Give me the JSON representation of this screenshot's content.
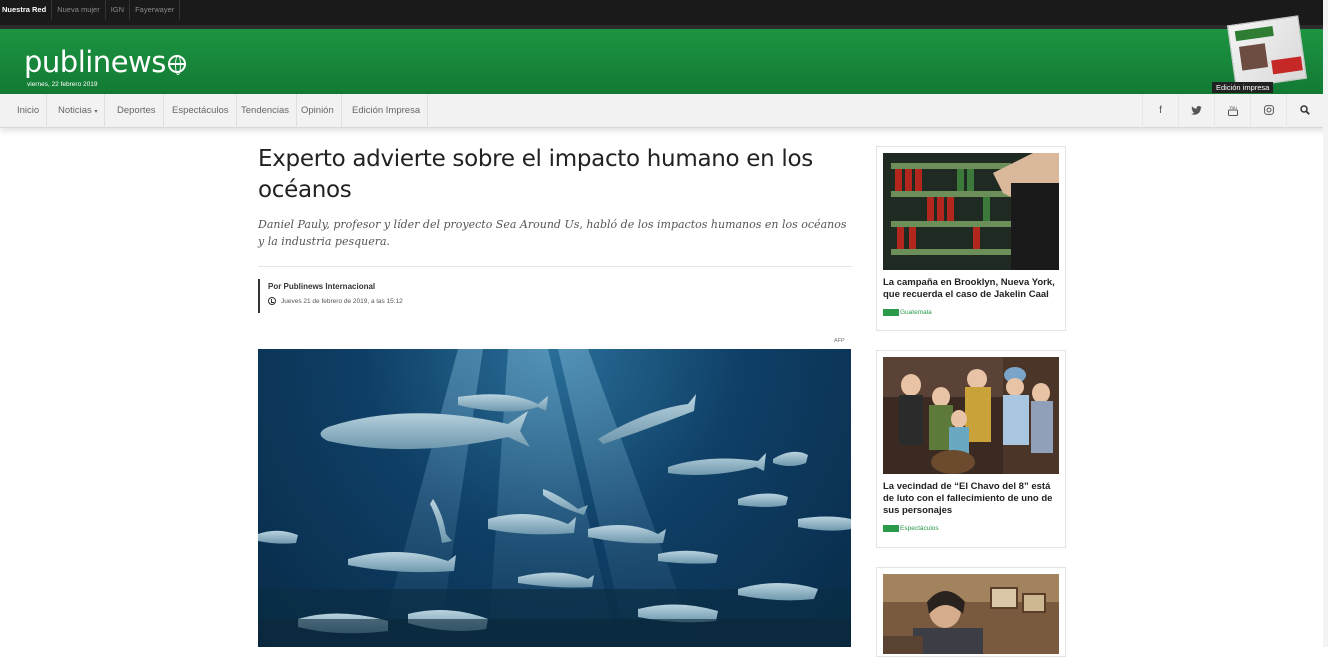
{
  "network": {
    "label": "Nuestra Red",
    "links": [
      "Nueva mujer",
      "IGN",
      "Fayerwayer"
    ]
  },
  "header": {
    "logo": "publinews",
    "date": "viernes, 22 febrero 2019",
    "print_label": "Edición impresa"
  },
  "nav": {
    "items": [
      "Inicio",
      "Noticias",
      "Deportes",
      "Espectáculos",
      "Tendencias",
      "Opinión",
      "Edición Impresa"
    ],
    "social": [
      "facebook-icon",
      "twitter-icon",
      "youtube-icon",
      "instagram-icon",
      "search-icon"
    ],
    "social_glyphs": [
      "f",
      "🐦",
      "▶",
      "◎",
      "⚲"
    ]
  },
  "article": {
    "title": "Experto advierte sobre el impacto humano en los océanos",
    "subtitle": "Daniel Pauly, profesor y líder del proyecto Sea Around Us, habló de los impactos humanos en los océanos y la industria pesquera.",
    "author": "Por Publinews Internacional",
    "timestamp": "Jueves 21 de febrero de 2019, a las 15:12",
    "photo_credit": "AFP"
  },
  "sidebar": {
    "cards": [
      {
        "title": "La campaña en Brooklyn, Nueva York, que recuerda el caso de Jakelin Caal",
        "tag": "Guatemala"
      },
      {
        "title": "La vecindad de “El Chavo del 8” está de luto con el fallecimiento de uno de sus personajes",
        "tag": "Espectáculos"
      },
      {
        "title": "",
        "tag": ""
      }
    ]
  },
  "colors": {
    "brand_green": "#1d9441",
    "tag_green": "#2b9a4b",
    "topbar": "#1a1a1a"
  }
}
